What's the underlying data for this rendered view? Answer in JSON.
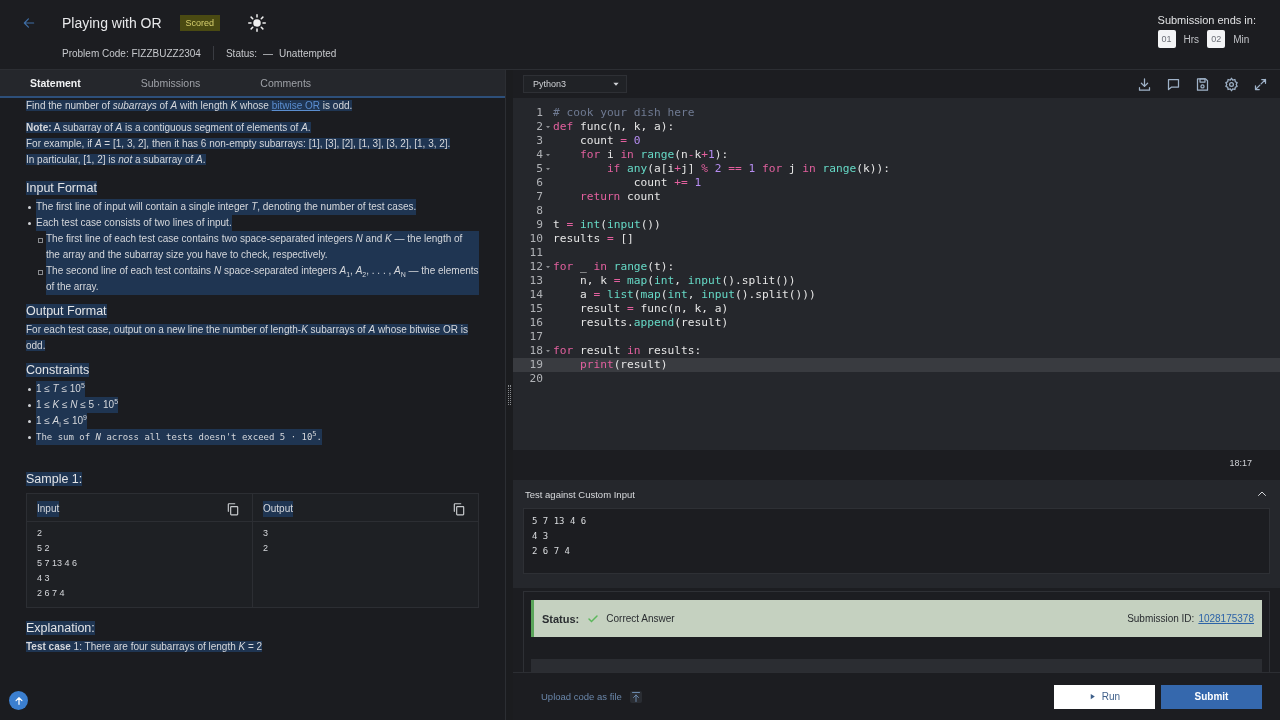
{
  "header": {
    "title": "Playing with OR",
    "badge": "Scored",
    "problem_code": "Problem Code: FIZZBUZZ2304",
    "status_label": "Status:",
    "status_dash": "—",
    "status_value": "Unattempted",
    "timer": {
      "label": "Submission ends in:",
      "hours": "01",
      "hours_unit": "Hrs",
      "minutes": "02",
      "minutes_unit": "Min"
    }
  },
  "tabs": [
    {
      "label": "Statement",
      "selected": true
    },
    {
      "label": "Submissions",
      "selected": false
    },
    {
      "label": "Comments",
      "selected": false
    }
  ],
  "statement": {
    "text_selected": true,
    "intro": {
      "before": "Find the number of *subarrays* of *A* with length *K* whose ",
      "link": "bitwise OR",
      "after": " is odd."
    },
    "note": [
      "**Note:** A subarray of *A* is a contiguous segment of elements of *A*.",
      "For example, if *A* = [1, 3, 2], then it has 6 non-empty subarrays: [1], [3], [2], [1, 3], [3, 2], [1, 3, 2].",
      "In particular, [1, 2] is *not* a subarray of *A*."
    ],
    "sections": [
      {
        "heading": "Input Format",
        "kind": "bullets",
        "items": [
          {
            "text": "The first line of input will contain a single integer *T*, denoting the number of test cases."
          },
          {
            "text": "Each test case consists of two lines of input.",
            "children": [
              {
                "text": "The first line of each test case contains two space-separated integers *N* and *K* — the length of the array and the subarray size you have to check, respectively."
              },
              {
                "text": "The second line of each test contains *N* space-separated integers *A*$_{1}$, *A*$_{2}$, . . . , *A*$_{N}$ — the elements of the array."
              }
            ]
          }
        ]
      },
      {
        "heading": "Output Format",
        "kind": "paragraph",
        "text": "For each test case, output on a new line the number of length-*K* subarrays of *A* whose bitwise OR is odd."
      },
      {
        "heading": "Constraints",
        "kind": "bullets",
        "items": [
          {
            "text": "1 ≤ *T* ≤ 10$^{5}$"
          },
          {
            "text": "1 ≤ *K* ≤ *N* ≤ 5 · 10$^{5}$"
          },
          {
            "text": "1 ≤ *A*$_{i}$ ≤ 10$^{9}$"
          },
          {
            "text": "The sum of *N* across all tests doesn't exceed 5 · 10$^{5}$.",
            "mono": true
          }
        ]
      },
      {
        "heading": "Sample 1:",
        "kind": "sample",
        "input_label": "Input",
        "output_label": "Output",
        "input_lines": [
          "2",
          "5 2",
          "5 7 13 4 6",
          "4 3",
          "2 6 7 4"
        ],
        "output_lines": [
          "3",
          "2"
        ]
      },
      {
        "heading": "Explanation:",
        "kind": "paragraph",
        "text": "**Test case** 1: There are four subarrays of length *K* = 2"
      }
    ]
  },
  "editor": {
    "language": "Python3",
    "lines": [
      {
        "n": "1",
        "fold": false,
        "current": false,
        "code": [
          {
            "kind": "comment",
            "text": "# cook your dish here"
          }
        ]
      },
      {
        "n": "2",
        "fold": true,
        "current": false,
        "code": [
          {
            "kind": "keyword",
            "text": "def"
          },
          {
            "kind": "plain",
            "text": " func(n, k, a):"
          }
        ]
      },
      {
        "n": "3",
        "fold": false,
        "current": false,
        "code": [
          {
            "kind": "plain",
            "text": "    count "
          },
          {
            "kind": "operator",
            "text": "="
          },
          {
            "kind": "number",
            "text": " 0"
          }
        ]
      },
      {
        "n": "4",
        "fold": true,
        "current": false,
        "code": [
          {
            "kind": "keyword",
            "text": "    for"
          },
          {
            "kind": "plain",
            "text": " i "
          },
          {
            "kind": "keyword",
            "text": "in"
          },
          {
            "kind": "builtin",
            "text": " range"
          },
          {
            "kind": "plain",
            "text": "(n"
          },
          {
            "kind": "operator",
            "text": "-"
          },
          {
            "kind": "plain",
            "text": "k"
          },
          {
            "kind": "operator",
            "text": "+"
          },
          {
            "kind": "number",
            "text": "1"
          },
          {
            "kind": "plain",
            "text": "):"
          }
        ]
      },
      {
        "n": "5",
        "fold": true,
        "current": false,
        "code": [
          {
            "kind": "keyword",
            "text": "        if"
          },
          {
            "kind": "builtin",
            "text": " any"
          },
          {
            "kind": "plain",
            "text": "(a[i"
          },
          {
            "kind": "operator",
            "text": "+"
          },
          {
            "kind": "plain",
            "text": "j] "
          },
          {
            "kind": "operator",
            "text": "%"
          },
          {
            "kind": "number",
            "text": " 2"
          },
          {
            "kind": "operator",
            "text": " =="
          },
          {
            "kind": "number",
            "text": " 1"
          },
          {
            "kind": "keyword",
            "text": " for"
          },
          {
            "kind": "plain",
            "text": " j "
          },
          {
            "kind": "keyword",
            "text": "in"
          },
          {
            "kind": "builtin",
            "text": " range"
          },
          {
            "kind": "plain",
            "text": "(k)):"
          }
        ]
      },
      {
        "n": "6",
        "fold": false,
        "current": false,
        "code": [
          {
            "kind": "plain",
            "text": "            count "
          },
          {
            "kind": "operator",
            "text": "+="
          },
          {
            "kind": "number",
            "text": " 1"
          }
        ]
      },
      {
        "n": "7",
        "fold": false,
        "current": false,
        "code": [
          {
            "kind": "keyword",
            "text": "    return"
          },
          {
            "kind": "plain",
            "text": " count"
          }
        ]
      },
      {
        "n": "8",
        "fold": false,
        "current": false
      },
      {
        "n": "9",
        "fold": false,
        "current": false,
        "code": [
          {
            "kind": "plain",
            "text": "t "
          },
          {
            "kind": "operator",
            "text": "="
          },
          {
            "kind": "builtin",
            "text": " int"
          },
          {
            "kind": "plain",
            "text": "("
          },
          {
            "kind": "builtin",
            "text": "input"
          },
          {
            "kind": "plain",
            "text": "())"
          }
        ]
      },
      {
        "n": "10",
        "fold": false,
        "current": false,
        "code": [
          {
            "kind": "plain",
            "text": "results "
          },
          {
            "kind": "operator",
            "text": "="
          },
          {
            "kind": "plain",
            "text": " []"
          }
        ]
      },
      {
        "n": "11",
        "fold": false,
        "current": false
      },
      {
        "n": "12",
        "fold": true,
        "current": false,
        "code": [
          {
            "kind": "keyword",
            "text": "for"
          },
          {
            "kind": "plain",
            "text": " _ "
          },
          {
            "kind": "keyword",
            "text": "in"
          },
          {
            "kind": "builtin",
            "text": " range"
          },
          {
            "kind": "plain",
            "text": "(t):"
          }
        ]
      },
      {
        "n": "13",
        "fold": false,
        "current": false,
        "code": [
          {
            "kind": "plain",
            "text": "    n, k "
          },
          {
            "kind": "operator",
            "text": "="
          },
          {
            "kind": "builtin",
            "text": " map"
          },
          {
            "kind": "plain",
            "text": "("
          },
          {
            "kind": "builtin",
            "text": "int"
          },
          {
            "kind": "plain",
            "text": ", "
          },
          {
            "kind": "builtin",
            "text": "input"
          },
          {
            "kind": "plain",
            "text": "().split())"
          }
        ]
      },
      {
        "n": "14",
        "fold": false,
        "current": false,
        "code": [
          {
            "kind": "plain",
            "text": "    a "
          },
          {
            "kind": "operator",
            "text": "="
          },
          {
            "kind": "builtin",
            "text": " list"
          },
          {
            "kind": "plain",
            "text": "("
          },
          {
            "kind": "builtin",
            "text": "map"
          },
          {
            "kind": "plain",
            "text": "("
          },
          {
            "kind": "builtin",
            "text": "int"
          },
          {
            "kind": "plain",
            "text": ", "
          },
          {
            "kind": "builtin",
            "text": "input"
          },
          {
            "kind": "plain",
            "text": "().split()))"
          }
        ]
      },
      {
        "n": "15",
        "fold": false,
        "current": false,
        "code": [
          {
            "kind": "plain",
            "text": "    result "
          },
          {
            "kind": "operator",
            "text": "="
          },
          {
            "kind": "plain",
            "text": " func(n, k, a)"
          }
        ]
      },
      {
        "n": "16",
        "fold": false,
        "current": false,
        "code": [
          {
            "kind": "plain",
            "text": "    results."
          },
          {
            "kind": "builtin",
            "text": "append"
          },
          {
            "kind": "plain",
            "text": "(result)"
          }
        ]
      },
      {
        "n": "17",
        "fold": false,
        "current": false
      },
      {
        "n": "18",
        "fold": true,
        "current": false,
        "code": [
          {
            "kind": "keyword",
            "text": "for"
          },
          {
            "kind": "plain",
            "text": " result "
          },
          {
            "kind": "keyword",
            "text": "in"
          },
          {
            "kind": "plain",
            "text": " results:"
          }
        ]
      },
      {
        "n": "19",
        "fold": false,
        "current": true,
        "code": [
          {
            "kind": "keyword",
            "text": "    print"
          },
          {
            "kind": "plain",
            "text": "(result)"
          }
        ]
      },
      {
        "n": "20",
        "fold": false,
        "current": false
      }
    ],
    "cursor": "18:17"
  },
  "custom_input": {
    "title": "Test against Custom Input",
    "expanded": true,
    "value": "5 7 13 4 6\n4 3\n2 6 7 4"
  },
  "result": {
    "status_label": "Status:",
    "status": "Correct Answer",
    "submission_label": "Submission ID:",
    "submission_id": "1028175378"
  },
  "footer": {
    "upload": "Upload code as file",
    "run": "Run",
    "submit": "Submit"
  }
}
